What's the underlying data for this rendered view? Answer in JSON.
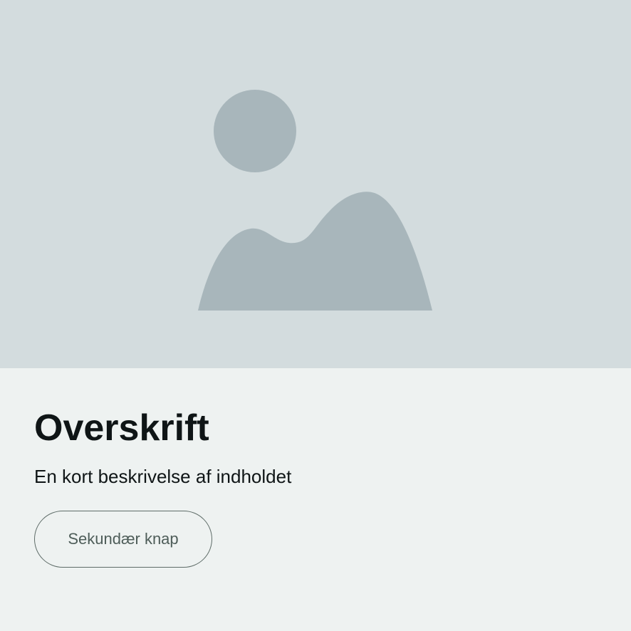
{
  "card": {
    "image": {
      "icon": "image-placeholder-icon",
      "background_color": "#d3dcde",
      "icon_color": "#a8b6bb"
    },
    "heading": "Overskrift",
    "description": "En kort beskrivelse af indholdet",
    "secondary_button_label": "Sekundær knap"
  },
  "colors": {
    "card_background": "#eef2f1",
    "text": "#0f1516",
    "button_border": "#5e6c68",
    "button_text": "#4e5d59"
  }
}
